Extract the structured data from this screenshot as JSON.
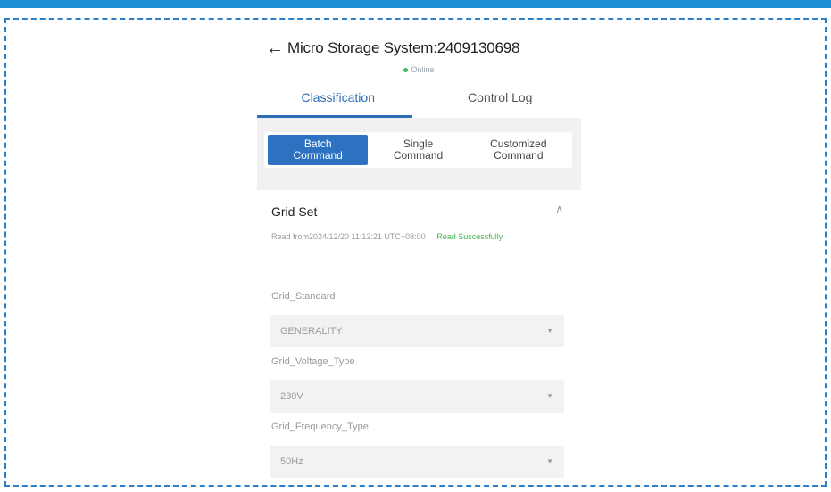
{
  "header": {
    "back_icon": "←",
    "title": "Micro Storage System:2409130698",
    "status": "Online"
  },
  "tabs": [
    {
      "label": "Classification"
    },
    {
      "label": "Control Log"
    }
  ],
  "segments": [
    {
      "label": "Batch\nCommand"
    },
    {
      "label": "Single\nCommand"
    },
    {
      "label": "Customized\nCommand"
    }
  ],
  "grid_set": {
    "title": "Grid Set",
    "chevron_icon": "^",
    "read_text": "Read from2024/12/20 11:12:21 UTC+08:00",
    "read_status": "Read Successfully",
    "fields": [
      {
        "label": "Grid_Standard",
        "value": "GENERALITY"
      },
      {
        "label": "Grid_Voltage_Type",
        "value": "230V"
      },
      {
        "label": "Grid_Frequency_Type",
        "value": "50Hz"
      }
    ]
  },
  "colors": {
    "accent": "#2d6db3",
    "top_bar": "#1e90d6",
    "success": "#49b34f",
    "online": "#3dbb5e"
  }
}
